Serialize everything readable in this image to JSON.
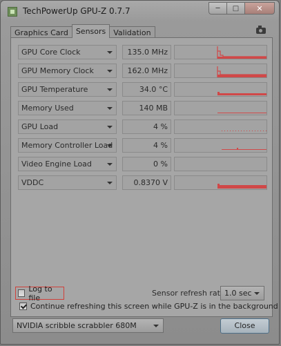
{
  "window": {
    "title": "TechPowerUp GPU-Z 0.7.7",
    "min_icon": "minimize-icon",
    "max_icon": "maximize-icon",
    "close_icon": "close-icon"
  },
  "tabs": [
    {
      "label": "Graphics Card",
      "active": false
    },
    {
      "label": "Sensors",
      "active": true
    },
    {
      "label": "Validation",
      "active": false
    }
  ],
  "toolbar": {
    "screenshot_icon": "camera-icon"
  },
  "sensors": [
    {
      "name": "GPU Core Clock",
      "value": "135.0 MHz"
    },
    {
      "name": "GPU Memory Clock",
      "value": "162.0 MHz"
    },
    {
      "name": "GPU Temperature",
      "value": "34.0 °C"
    },
    {
      "name": "Memory Used",
      "value": "140 MB"
    },
    {
      "name": "GPU Load",
      "value": "4 %"
    },
    {
      "name": "Memory Controller Load",
      "value": "4 %"
    },
    {
      "name": "Video Engine Load",
      "value": "0 %"
    },
    {
      "name": "VDDC",
      "value": "0.8370 V"
    }
  ],
  "footer": {
    "log_to_file_label": "Log to file",
    "log_to_file_checked": false,
    "refresh_rate_label": "Sensor refresh rate:",
    "refresh_rate_value": "1.0 sec",
    "background_refresh_label": "Continue refreshing this screen while GPU-Z is in the background",
    "background_refresh_checked": true,
    "gpu_select_value": "NVIDIA scribble scrabbler 680M",
    "close_label": "Close"
  },
  "colors": {
    "graph_line": "#d04848",
    "highlight_border": "#d0403a"
  }
}
